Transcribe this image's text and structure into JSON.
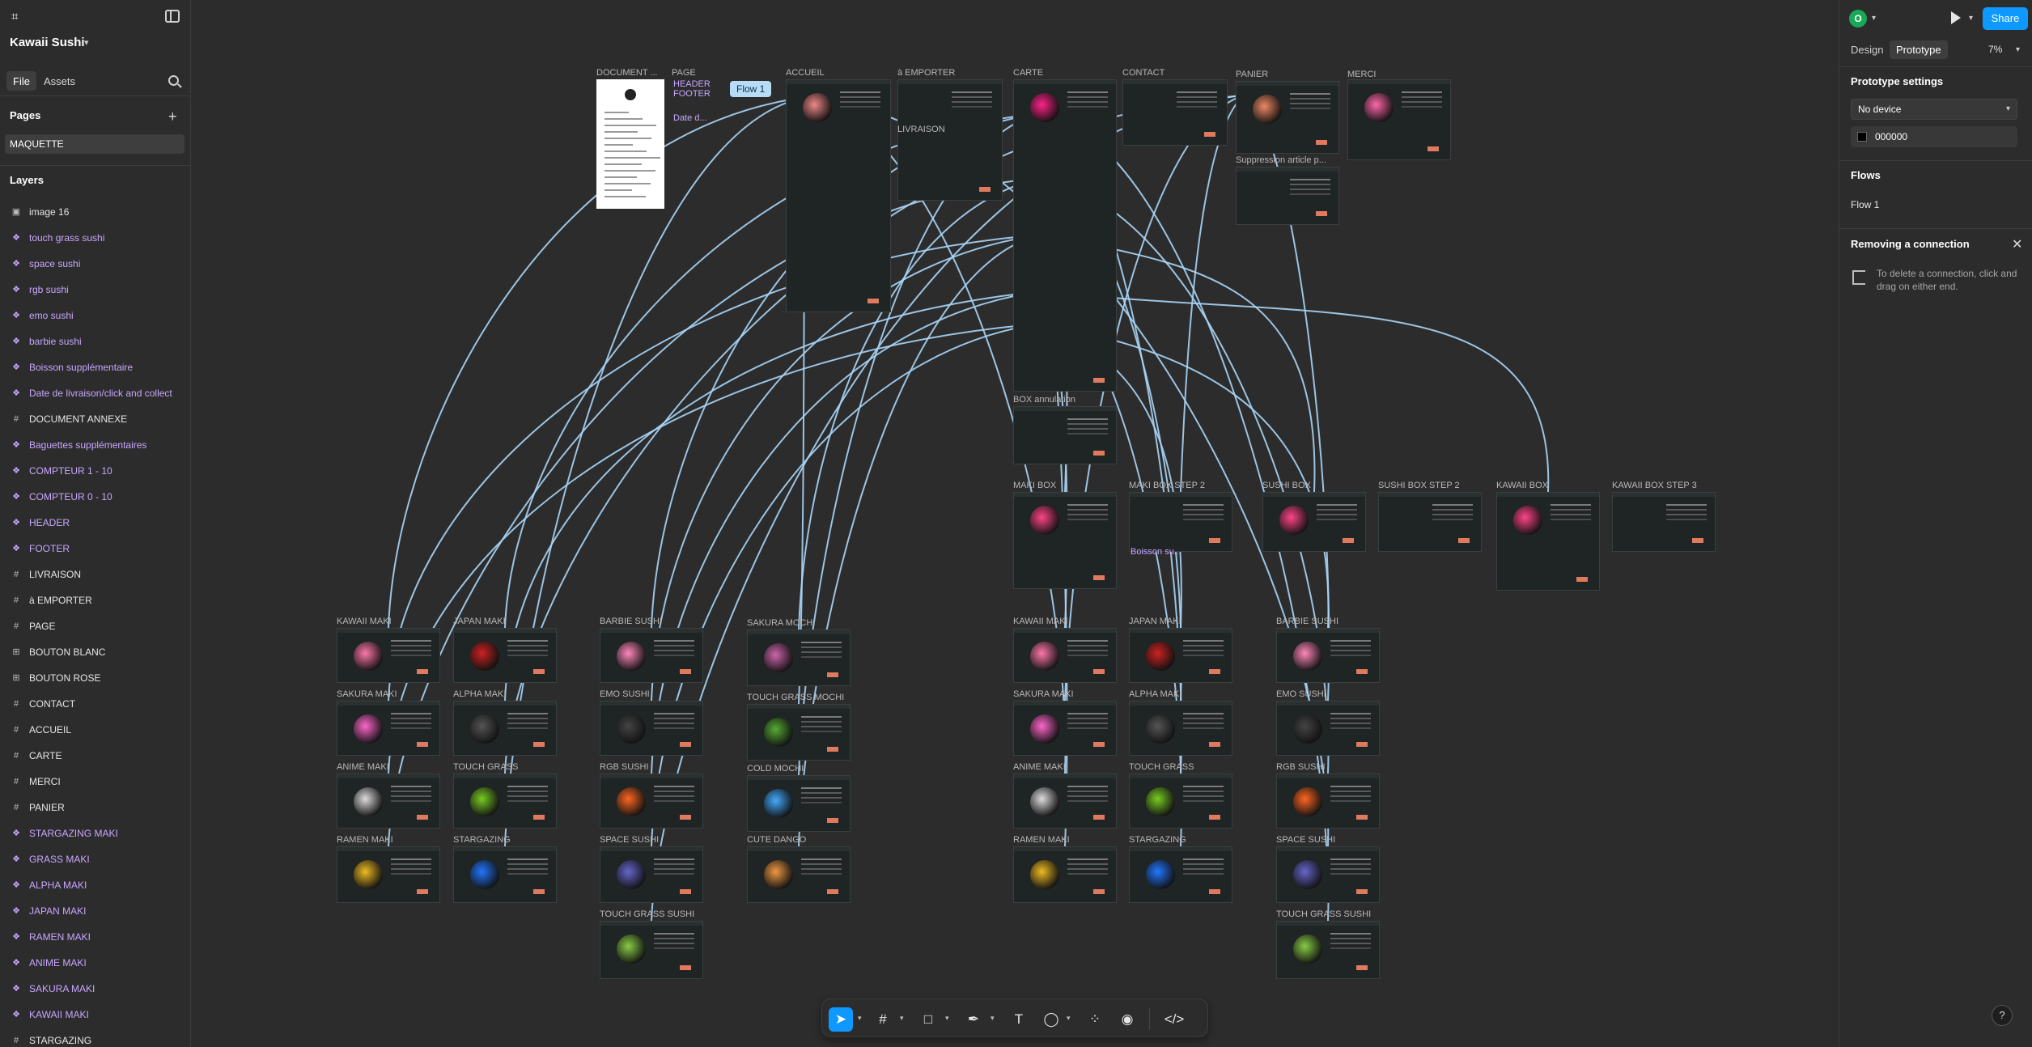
{
  "file": {
    "name": "Kawaii Sushi"
  },
  "left_panel": {
    "tabs": [
      "File",
      "Assets"
    ],
    "pages_title": "Pages",
    "pages": [
      "MAQUETTE"
    ],
    "layers_title": "Layers",
    "layers": [
      {
        "label": "image 16",
        "kind": "image"
      },
      {
        "label": "touch grass sushi",
        "kind": "component"
      },
      {
        "label": "space sushi",
        "kind": "component"
      },
      {
        "label": "rgb sushi",
        "kind": "component"
      },
      {
        "label": "emo sushi",
        "kind": "component"
      },
      {
        "label": "barbie sushi",
        "kind": "component"
      },
      {
        "label": "Boisson supplémentaire",
        "kind": "component"
      },
      {
        "label": "Date de livraison/click and collect",
        "kind": "component"
      },
      {
        "label": "DOCUMENT ANNEXE",
        "kind": "frame"
      },
      {
        "label": "Baguettes supplémentaires",
        "kind": "component"
      },
      {
        "label": "COMPTEUR 1 - 10",
        "kind": "component"
      },
      {
        "label": "COMPTEUR 0 - 10",
        "kind": "component"
      },
      {
        "label": "HEADER",
        "kind": "component"
      },
      {
        "label": "FOOTER",
        "kind": "component"
      },
      {
        "label": "LIVRAISON",
        "kind": "frame"
      },
      {
        "label": "à EMPORTER",
        "kind": "frame"
      },
      {
        "label": "PAGE",
        "kind": "frame"
      },
      {
        "label": "BOUTON BLANC",
        "kind": "autolayout"
      },
      {
        "label": "BOUTON ROSE",
        "kind": "autolayout"
      },
      {
        "label": "CONTACT",
        "kind": "frame"
      },
      {
        "label": "ACCUEIL",
        "kind": "frame"
      },
      {
        "label": "CARTE",
        "kind": "frame"
      },
      {
        "label": "MERCI",
        "kind": "frame"
      },
      {
        "label": "PANIER",
        "kind": "frame"
      },
      {
        "label": "STARGAZING MAKI",
        "kind": "component"
      },
      {
        "label": "GRASS MAKI",
        "kind": "component"
      },
      {
        "label": "ALPHA MAKI",
        "kind": "component"
      },
      {
        "label": "JAPAN MAKI",
        "kind": "component"
      },
      {
        "label": "RAMEN MAKI",
        "kind": "component"
      },
      {
        "label": "ANIME MAKI",
        "kind": "component"
      },
      {
        "label": "SAKURA MAKI",
        "kind": "component"
      },
      {
        "label": "KAWAII MAKI",
        "kind": "component"
      },
      {
        "label": "STARGAZING",
        "kind": "frame"
      }
    ]
  },
  "right_panel": {
    "avatar_initial": "O",
    "share_label": "Share",
    "tabs": [
      "Design",
      "Prototype"
    ],
    "zoom": "7%",
    "prototype_settings_title": "Prototype settings",
    "device": "No device",
    "background_color": "000000",
    "flows_title": "Flows",
    "flows": [
      "Flow 1"
    ],
    "removing_title": "Removing a connection",
    "removing_hint": "To delete a connection, click and drag on either end.",
    "help": "?"
  },
  "canvas": {
    "flow_badge": "Flow 1",
    "frames": [
      {
        "label": "DOCUMENT ...",
        "kind": "doc"
      },
      {
        "label": "PAGE"
      },
      {
        "label": "ACCUEIL"
      },
      {
        "label": "à EMPORTER"
      },
      {
        "label": "LIVRAISON"
      },
      {
        "label": "CARTE"
      },
      {
        "label": "CONTACT"
      },
      {
        "label": "PANIER"
      },
      {
        "label": "MERCI"
      },
      {
        "label": "Suppression article p..."
      },
      {
        "label": "BOX annulation"
      },
      {
        "label": "MAKI BOX"
      },
      {
        "label": "MAKI BOX STEP 2"
      },
      {
        "label": "SUSHI BOX"
      },
      {
        "label": "SUSHI BOX STEP 2"
      },
      {
        "label": "KAWAII BOX"
      },
      {
        "label": "KAWAII BOX STEP 3"
      },
      {
        "label": "KAWAII MAKI"
      },
      {
        "label": "JAPAN MAKI"
      },
      {
        "label": "SAKURA MAKI"
      },
      {
        "label": "ALPHA MAKI"
      },
      {
        "label": "ANIME MAKI"
      },
      {
        "label": "TOUCH GRASS"
      },
      {
        "label": "RAMEN MAKI"
      },
      {
        "label": "STARGAZING"
      },
      {
        "label": "BARBIE SUSHI"
      },
      {
        "label": "EMO SUSHI"
      },
      {
        "label": "RGB SUSHI"
      },
      {
        "label": "SPACE SUSHI"
      },
      {
        "label": "TOUCH GRASS SUSHI"
      },
      {
        "label": "SAKURA MOCHI"
      },
      {
        "label": "TOUCH GRASS MOCHI"
      },
      {
        "label": "COLD MOCHI"
      },
      {
        "label": "CUTE DANGO"
      },
      {
        "label": "KAWAII MAKI"
      },
      {
        "label": "JAPAN MAKI"
      },
      {
        "label": "SAKURA MAKI"
      },
      {
        "label": "ALPHA MAKI"
      },
      {
        "label": "ANIME MAKI"
      },
      {
        "label": "TOUCH GRASS"
      },
      {
        "label": "RAMEN MAKI"
      },
      {
        "label": "STARGAZING"
      },
      {
        "label": "BARBIE SUSHI"
      },
      {
        "label": "EMO SUSHI"
      },
      {
        "label": "RGB SUSHI"
      },
      {
        "label": "SPACE SUSHI"
      },
      {
        "label": "TOUCH GRASS SUSHI"
      }
    ],
    "overlay_labels": [
      "HEADER",
      "FOOTER",
      "Date d...",
      "Boisson su..."
    ],
    "connection_color": "#a8d5f7"
  },
  "toolbar": {
    "tools": [
      "move-tool",
      "frame-tool",
      "shape-tool",
      "pen-tool",
      "text-tool",
      "comment-tool",
      "actions-tool",
      "avatar-tool",
      "dev-mode-toggle"
    ]
  }
}
